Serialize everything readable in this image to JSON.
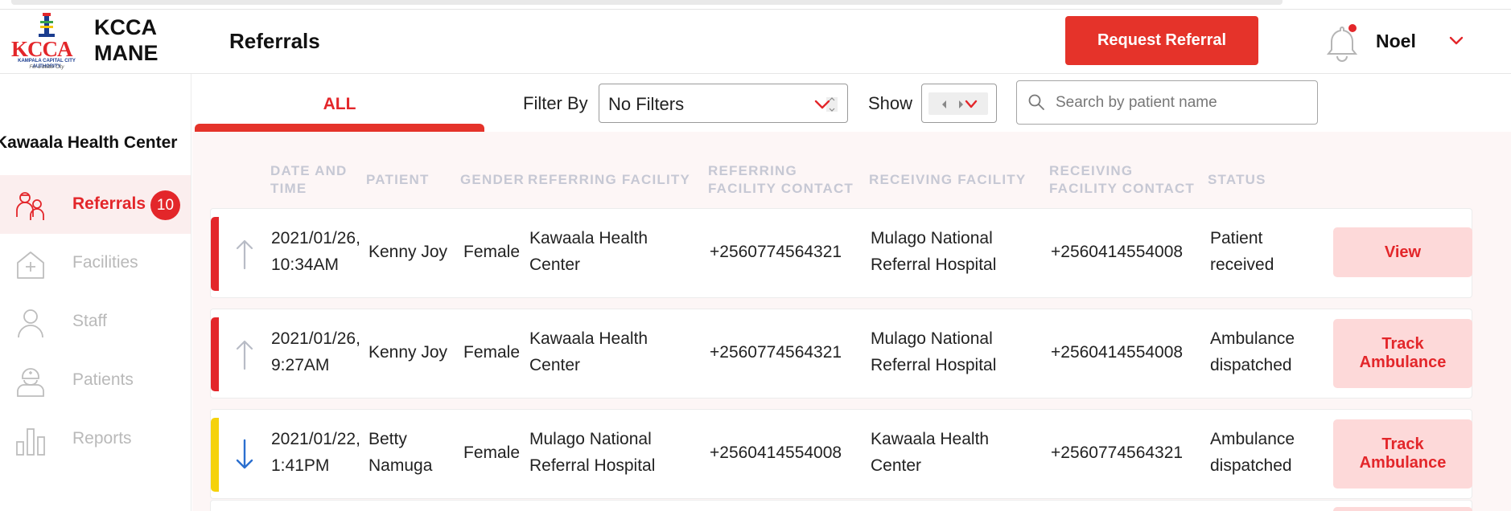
{
  "app": {
    "logo_text": "KCCA",
    "logo_subtitle": "KAMPALA CAPITAL CITY AUTHORITY",
    "logo_tagline": "For a better City",
    "name_line1": "KCCA",
    "name_line2": "MANE"
  },
  "header": {
    "page_title": "Referrals",
    "request_button": "Request Referral",
    "user_name": "Noel",
    "has_notification": true
  },
  "sidebar": {
    "facility_name": "Kawaala Health Center",
    "items": [
      {
        "label": "Referrals",
        "icon": "doctors-icon",
        "active": true,
        "badge": "10"
      },
      {
        "label": "Facilities",
        "icon": "hospital-icon",
        "active": false
      },
      {
        "label": "Staff",
        "icon": "person-icon",
        "active": false
      },
      {
        "label": "Patients",
        "icon": "patient-icon",
        "active": false
      },
      {
        "label": "Reports",
        "icon": "bar-chart-icon",
        "active": false
      }
    ]
  },
  "filters": {
    "tab_label": "ALL",
    "filter_by_label": "Filter By",
    "filter_value": "No Filters",
    "show_label": "Show",
    "search_placeholder": "Search by patient name"
  },
  "table": {
    "headers": {
      "date_time_1": "DATE AND",
      "date_time_2": "TIME",
      "patient": "PATIENT",
      "gender": "GENDER",
      "referring_facility": "REFERRING FACILITY",
      "referring_contact_1": "REFERRING",
      "referring_contact_2": "FACILITY CONTACT",
      "receiving_facility": "RECEIVING FACILITY",
      "receiving_contact_1": "RECEIVING",
      "receiving_contact_2": "FACILITY CONTACT",
      "status": "STATUS"
    },
    "rows": [
      {
        "date_1": "2021/01/26,",
        "date_2": "10:34AM",
        "patient_1": "Kenny Joy",
        "patient_2": "",
        "gender": "Female",
        "referring_1": "Kawaala Health",
        "referring_2": "Center",
        "referring_contact": "+2560774564321",
        "receiving_1": "Mulago National",
        "receiving_2": "Referral Hospital",
        "receiving_contact": "+2560414554008",
        "status_1": "Patient",
        "status_2": "received",
        "action_1": "View",
        "action_2": "",
        "direction": "outgoing",
        "stripe_color": "#e3262a"
      },
      {
        "date_1": "2021/01/26,",
        "date_2": "9:27AM",
        "patient_1": "Kenny Joy",
        "patient_2": "",
        "gender": "Female",
        "referring_1": "Kawaala Health",
        "referring_2": "Center",
        "referring_contact": "+2560774564321",
        "receiving_1": "Mulago National",
        "receiving_2": "Referral Hospital",
        "receiving_contact": "+2560414554008",
        "status_1": "Ambulance",
        "status_2": "dispatched",
        "action_1": "Track",
        "action_2": "Ambulance",
        "direction": "outgoing",
        "stripe_color": "#e3262a"
      },
      {
        "date_1": "2021/01/22,",
        "date_2": "1:41PM",
        "patient_1": "Betty",
        "patient_2": "Namuga",
        "gender": "Female",
        "referring_1": "Mulago National",
        "referring_2": "Referral Hospital",
        "referring_contact": "+2560414554008",
        "receiving_1": "Kawaala Health",
        "receiving_2": "Center",
        "receiving_contact": "+2560774564321",
        "status_1": "Ambulance",
        "status_2": "dispatched",
        "action_1": "Track",
        "action_2": "Ambulance",
        "direction": "incoming",
        "stripe_color": "#f5d20b"
      }
    ]
  },
  "colors": {
    "accent": "#e3262a",
    "action_bg": "#fdd9d9",
    "incoming_arrow": "#2b6fcf",
    "outgoing_arrow": "#b8bcc6"
  }
}
